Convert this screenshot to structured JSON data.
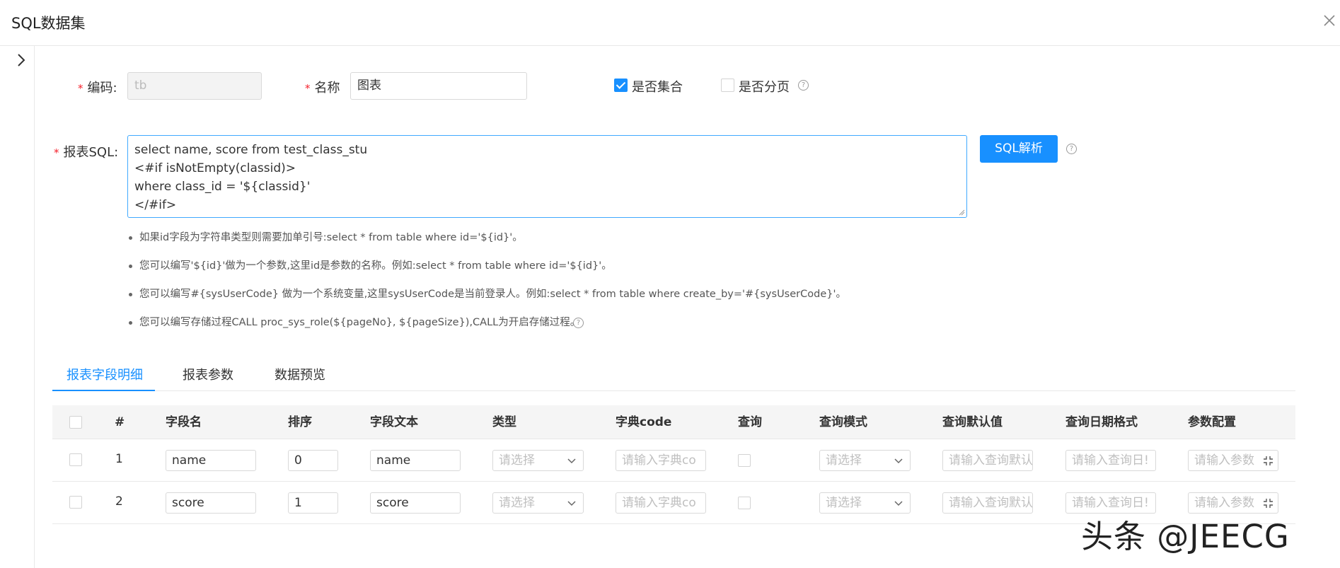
{
  "header": {
    "title": "SQL数据集"
  },
  "form": {
    "code_label": "编码:",
    "code_value": "tb",
    "name_label": "名称",
    "name_value": "图表",
    "is_collection_label": "是否集合",
    "is_collection_checked": true,
    "is_paged_label": "是否分页",
    "is_paged_checked": false,
    "sql_label": "报表SQL:",
    "sql_lines": [
      "select name, score from test_class_stu",
      "<#if isNotEmpty(classid)>",
      "where class_id = '${classid}'",
      "</#if>"
    ],
    "parse_button": "SQL解析",
    "required_mark": "*"
  },
  "tips": [
    "如果id字段为字符串类型则需要加单引号:select * from table where id='${id}'。",
    "您可以编写'${id}'做为一个参数,这里id是参数的名称。例如:select * from table where id='${id}'。",
    "您可以编写#{sysUserCode} 做为一个系统变量,这里sysUserCode是当前登录人。例如:select * from table where create_by='#{sysUserCode}'。",
    "您可以编写存储过程CALL proc_sys_role(${pageNo}, ${pageSize}),CALL为开启存储过程。"
  ],
  "tabs": [
    {
      "label": "报表字段明细",
      "active": true
    },
    {
      "label": "报表参数",
      "active": false
    },
    {
      "label": "数据预览",
      "active": false
    }
  ],
  "table": {
    "headers": [
      "#",
      "字段名",
      "排序",
      "字段文本",
      "类型",
      "字典code",
      "查询",
      "查询模式",
      "查询默认值",
      "查询日期格式",
      "参数配置"
    ],
    "placeholders": {
      "type": "请选择",
      "dict_code": "请输入字典co",
      "query_mode": "请选择",
      "query_default": "请输入查询默认",
      "date_format": "请输入查询日!",
      "param_config": "请输入参数"
    },
    "rows": [
      {
        "index": "1",
        "field_name": "name",
        "order": "0",
        "field_text": "name"
      },
      {
        "index": "2",
        "field_name": "score",
        "order": "1",
        "field_text": "score"
      }
    ]
  },
  "watermark": "头条 @JEECG",
  "colors": {
    "primary": "#1890ff",
    "required": "#f5222d"
  }
}
